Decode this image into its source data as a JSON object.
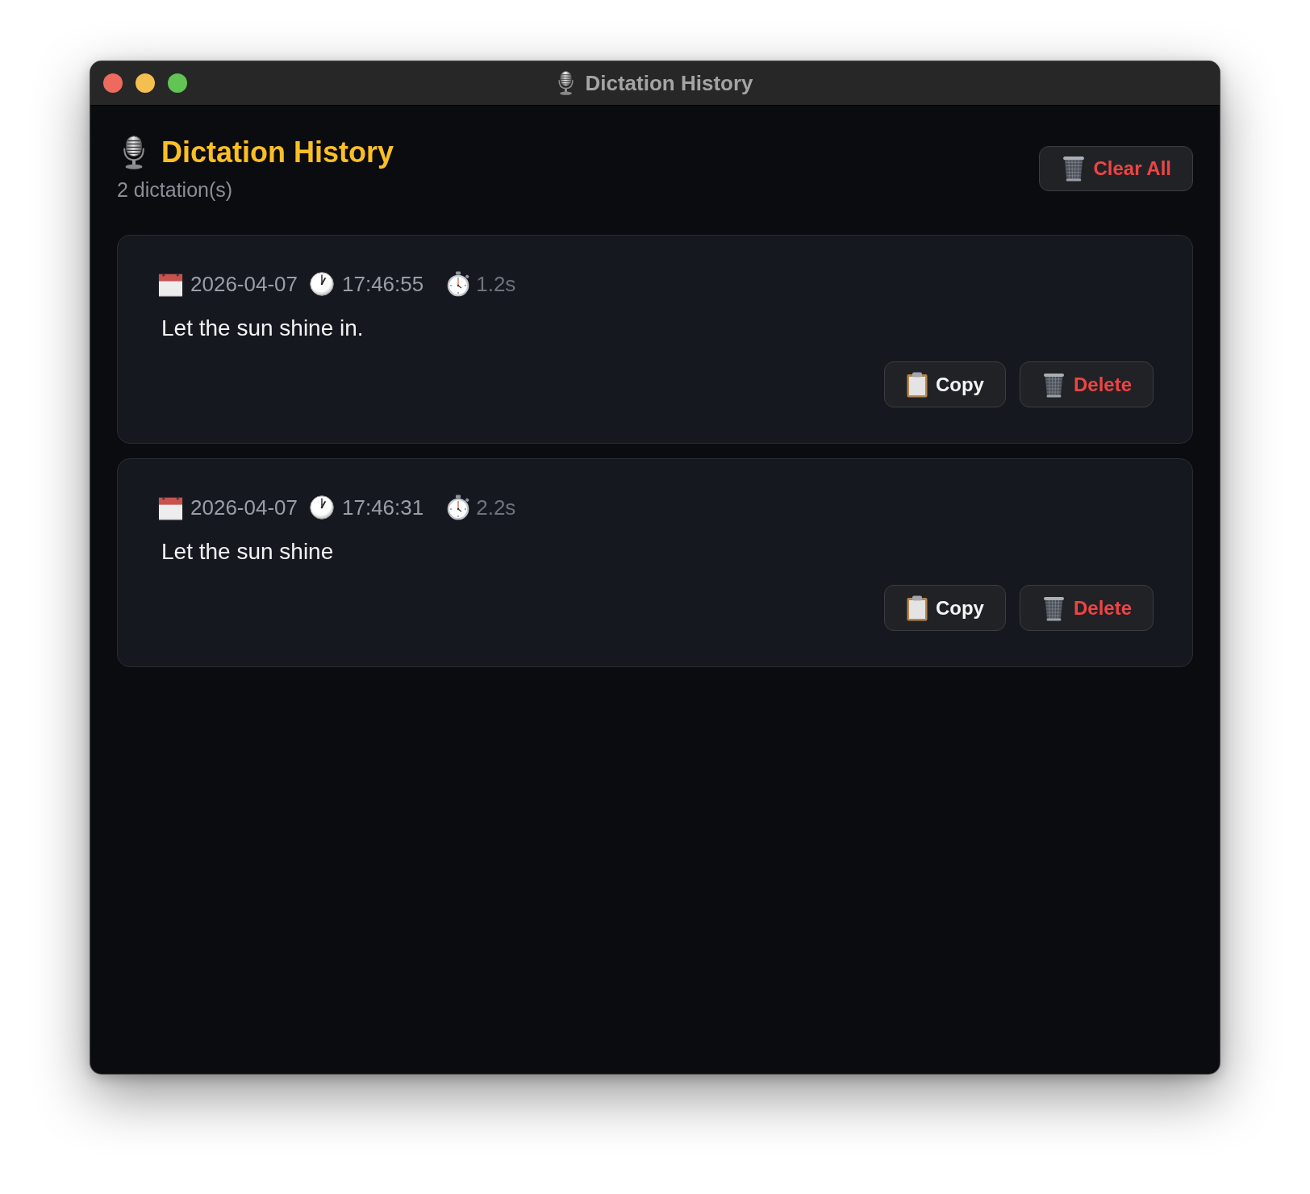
{
  "window": {
    "title": "Dictation History"
  },
  "header": {
    "title": "Dictation History",
    "count": "2 dictation(s)",
    "clear_label": "Clear All"
  },
  "dictations": [
    {
      "date": "2026-04-07",
      "time": "17:46:55",
      "duration": "1.2s",
      "text": "Let the sun shine in.",
      "actions": [
        {
          "kind": "copy",
          "label": "Copy"
        },
        {
          "kind": "delete",
          "label": "Delete"
        }
      ]
    },
    {
      "date": "2026-04-07",
      "time": "17:46:31",
      "duration": "2.2s",
      "text": "Let the sun shine",
      "actions": [
        {
          "kind": "copy",
          "label": "Copy"
        },
        {
          "kind": "delete",
          "label": "Delete"
        }
      ]
    }
  ]
}
